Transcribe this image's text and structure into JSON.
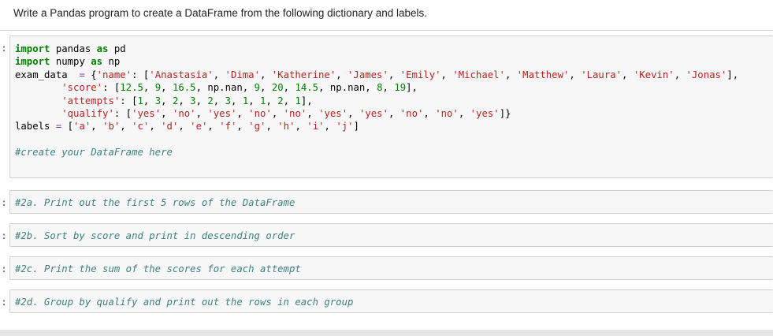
{
  "task_text": "Write a Pandas program to create a DataFrame from the following dictionary and labels.",
  "prompt_marker": ":",
  "main_cell": {
    "lines": [
      [
        {
          "t": "kw",
          "v": "import"
        },
        {
          "t": "",
          "v": " pandas "
        },
        {
          "t": "kw",
          "v": "as"
        },
        {
          "t": "",
          "v": " pd"
        }
      ],
      [
        {
          "t": "kw",
          "v": "import"
        },
        {
          "t": "",
          "v": " numpy "
        },
        {
          "t": "kw",
          "v": "as"
        },
        {
          "t": "",
          "v": " np"
        }
      ],
      [
        {
          "t": "",
          "v": "exam_data  "
        },
        {
          "t": "op",
          "v": "="
        },
        {
          "t": "",
          "v": " {"
        },
        {
          "t": "str",
          "v": "'name'"
        },
        {
          "t": "",
          "v": ": ["
        },
        {
          "t": "str",
          "v": "'Anastasia'"
        },
        {
          "t": "",
          "v": ", "
        },
        {
          "t": "str",
          "v": "'Dima'"
        },
        {
          "t": "",
          "v": ", "
        },
        {
          "t": "str",
          "v": "'Katherine'"
        },
        {
          "t": "",
          "v": ", "
        },
        {
          "t": "str",
          "v": "'James'"
        },
        {
          "t": "",
          "v": ", "
        },
        {
          "t": "str",
          "v": "'Emily'"
        },
        {
          "t": "",
          "v": ", "
        },
        {
          "t": "str",
          "v": "'Michael'"
        },
        {
          "t": "",
          "v": ", "
        },
        {
          "t": "str",
          "v": "'Matthew'"
        },
        {
          "t": "",
          "v": ", "
        },
        {
          "t": "str",
          "v": "'Laura'"
        },
        {
          "t": "",
          "v": ", "
        },
        {
          "t": "str",
          "v": "'Kevin'"
        },
        {
          "t": "",
          "v": ", "
        },
        {
          "t": "str",
          "v": "'Jonas'"
        },
        {
          "t": "",
          "v": "],"
        }
      ],
      [
        {
          "t": "",
          "v": "        "
        },
        {
          "t": "str",
          "v": "'score'"
        },
        {
          "t": "",
          "v": ": ["
        },
        {
          "t": "num",
          "v": "12.5"
        },
        {
          "t": "",
          "v": ", "
        },
        {
          "t": "num",
          "v": "9"
        },
        {
          "t": "",
          "v": ", "
        },
        {
          "t": "num",
          "v": "16.5"
        },
        {
          "t": "",
          "v": ", np.nan, "
        },
        {
          "t": "num",
          "v": "9"
        },
        {
          "t": "",
          "v": ", "
        },
        {
          "t": "num",
          "v": "20"
        },
        {
          "t": "",
          "v": ", "
        },
        {
          "t": "num",
          "v": "14.5"
        },
        {
          "t": "",
          "v": ", np.nan, "
        },
        {
          "t": "num",
          "v": "8"
        },
        {
          "t": "",
          "v": ", "
        },
        {
          "t": "num",
          "v": "19"
        },
        {
          "t": "",
          "v": "],"
        }
      ],
      [
        {
          "t": "",
          "v": "        "
        },
        {
          "t": "str",
          "v": "'attempts'"
        },
        {
          "t": "",
          "v": ": ["
        },
        {
          "t": "num",
          "v": "1"
        },
        {
          "t": "",
          "v": ", "
        },
        {
          "t": "num",
          "v": "3"
        },
        {
          "t": "",
          "v": ", "
        },
        {
          "t": "num",
          "v": "2"
        },
        {
          "t": "",
          "v": ", "
        },
        {
          "t": "num",
          "v": "3"
        },
        {
          "t": "",
          "v": ", "
        },
        {
          "t": "num",
          "v": "2"
        },
        {
          "t": "",
          "v": ", "
        },
        {
          "t": "num",
          "v": "3"
        },
        {
          "t": "",
          "v": ", "
        },
        {
          "t": "num",
          "v": "1"
        },
        {
          "t": "",
          "v": ", "
        },
        {
          "t": "num",
          "v": "1"
        },
        {
          "t": "",
          "v": ", "
        },
        {
          "t": "num",
          "v": "2"
        },
        {
          "t": "",
          "v": ", "
        },
        {
          "t": "num",
          "v": "1"
        },
        {
          "t": "",
          "v": "],"
        }
      ],
      [
        {
          "t": "",
          "v": "        "
        },
        {
          "t": "str",
          "v": "'qualify'"
        },
        {
          "t": "",
          "v": ": ["
        },
        {
          "t": "str",
          "v": "'yes'"
        },
        {
          "t": "",
          "v": ", "
        },
        {
          "t": "str",
          "v": "'no'"
        },
        {
          "t": "",
          "v": ", "
        },
        {
          "t": "str",
          "v": "'yes'"
        },
        {
          "t": "",
          "v": ", "
        },
        {
          "t": "str",
          "v": "'no'"
        },
        {
          "t": "",
          "v": ", "
        },
        {
          "t": "str",
          "v": "'no'"
        },
        {
          "t": "",
          "v": ", "
        },
        {
          "t": "str",
          "v": "'yes'"
        },
        {
          "t": "",
          "v": ", "
        },
        {
          "t": "str",
          "v": "'yes'"
        },
        {
          "t": "",
          "v": ", "
        },
        {
          "t": "str",
          "v": "'no'"
        },
        {
          "t": "",
          "v": ", "
        },
        {
          "t": "str",
          "v": "'no'"
        },
        {
          "t": "",
          "v": ", "
        },
        {
          "t": "str",
          "v": "'yes'"
        },
        {
          "t": "",
          "v": "]}"
        }
      ],
      [
        {
          "t": "",
          "v": "labels "
        },
        {
          "t": "op",
          "v": "="
        },
        {
          "t": "",
          "v": " ["
        },
        {
          "t": "str",
          "v": "'a'"
        },
        {
          "t": "",
          "v": ", "
        },
        {
          "t": "str",
          "v": "'b'"
        },
        {
          "t": "",
          "v": ", "
        },
        {
          "t": "str",
          "v": "'c'"
        },
        {
          "t": "",
          "v": ", "
        },
        {
          "t": "str",
          "v": "'d'"
        },
        {
          "t": "",
          "v": ", "
        },
        {
          "t": "str",
          "v": "'e'"
        },
        {
          "t": "",
          "v": ", "
        },
        {
          "t": "str",
          "v": "'f'"
        },
        {
          "t": "",
          "v": ", "
        },
        {
          "t": "str",
          "v": "'g'"
        },
        {
          "t": "",
          "v": ", "
        },
        {
          "t": "str",
          "v": "'h'"
        },
        {
          "t": "",
          "v": ", "
        },
        {
          "t": "str",
          "v": "'i'"
        },
        {
          "t": "",
          "v": ", "
        },
        {
          "t": "str",
          "v": "'j'"
        },
        {
          "t": "",
          "v": "]"
        }
      ],
      [
        {
          "t": "",
          "v": " "
        }
      ],
      [
        {
          "t": "cm",
          "v": "#create your DataFrame here"
        }
      ]
    ]
  },
  "comment_cells": [
    "#2a. Print out the first 5 rows of the DataFrame",
    "#2b. Sort by score and print in descending order",
    "#2c. Print the sum of the scores for each attempt",
    "#2d. Group by qualify and print out the rows in each group"
  ]
}
